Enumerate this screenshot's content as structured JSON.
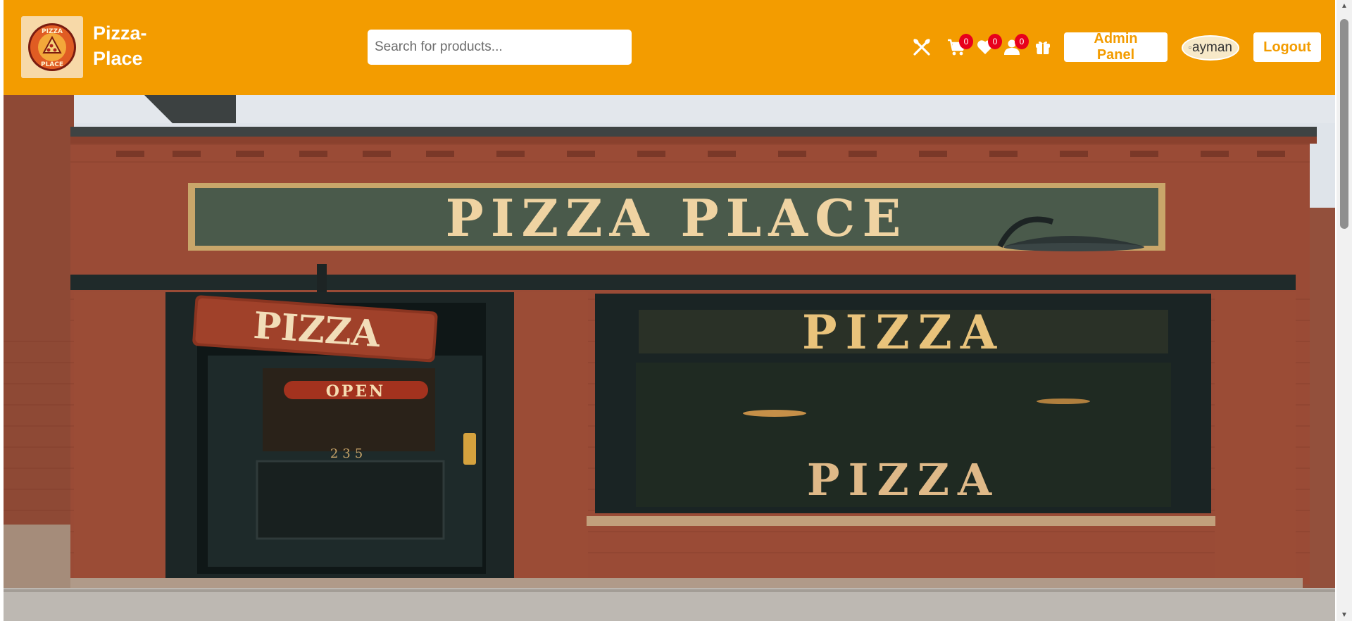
{
  "brand": {
    "name": "Pizza-Place",
    "logo_text_top": "PIZZA",
    "logo_text_bottom": "PLACE"
  },
  "search": {
    "placeholder": "Search for products..."
  },
  "nav_icons": [
    {
      "name": "utensils-icon"
    },
    {
      "name": "cart-icon",
      "count": "0"
    },
    {
      "name": "heart-icon",
      "count": "0"
    },
    {
      "name": "user-icon",
      "count": "0"
    },
    {
      "name": "gift-icon"
    }
  ],
  "buttons": {
    "admin": "Admin Panel",
    "logout": "Logout"
  },
  "avatar": {
    "alt": "ayman"
  },
  "hero": {
    "sign": "PIZZA PLACE",
    "hanging_sign": "PIZZA",
    "door_sign": "OPEN",
    "door_number": "235",
    "window_top": "PIZZA",
    "window_bottom": "PIZZA"
  },
  "colors": {
    "navbar": "#f39c00",
    "badge": "#e8001c",
    "brick": "#9a4b36",
    "sign_bg": "#4a5a4b",
    "sign_text": "#efd3a2"
  }
}
